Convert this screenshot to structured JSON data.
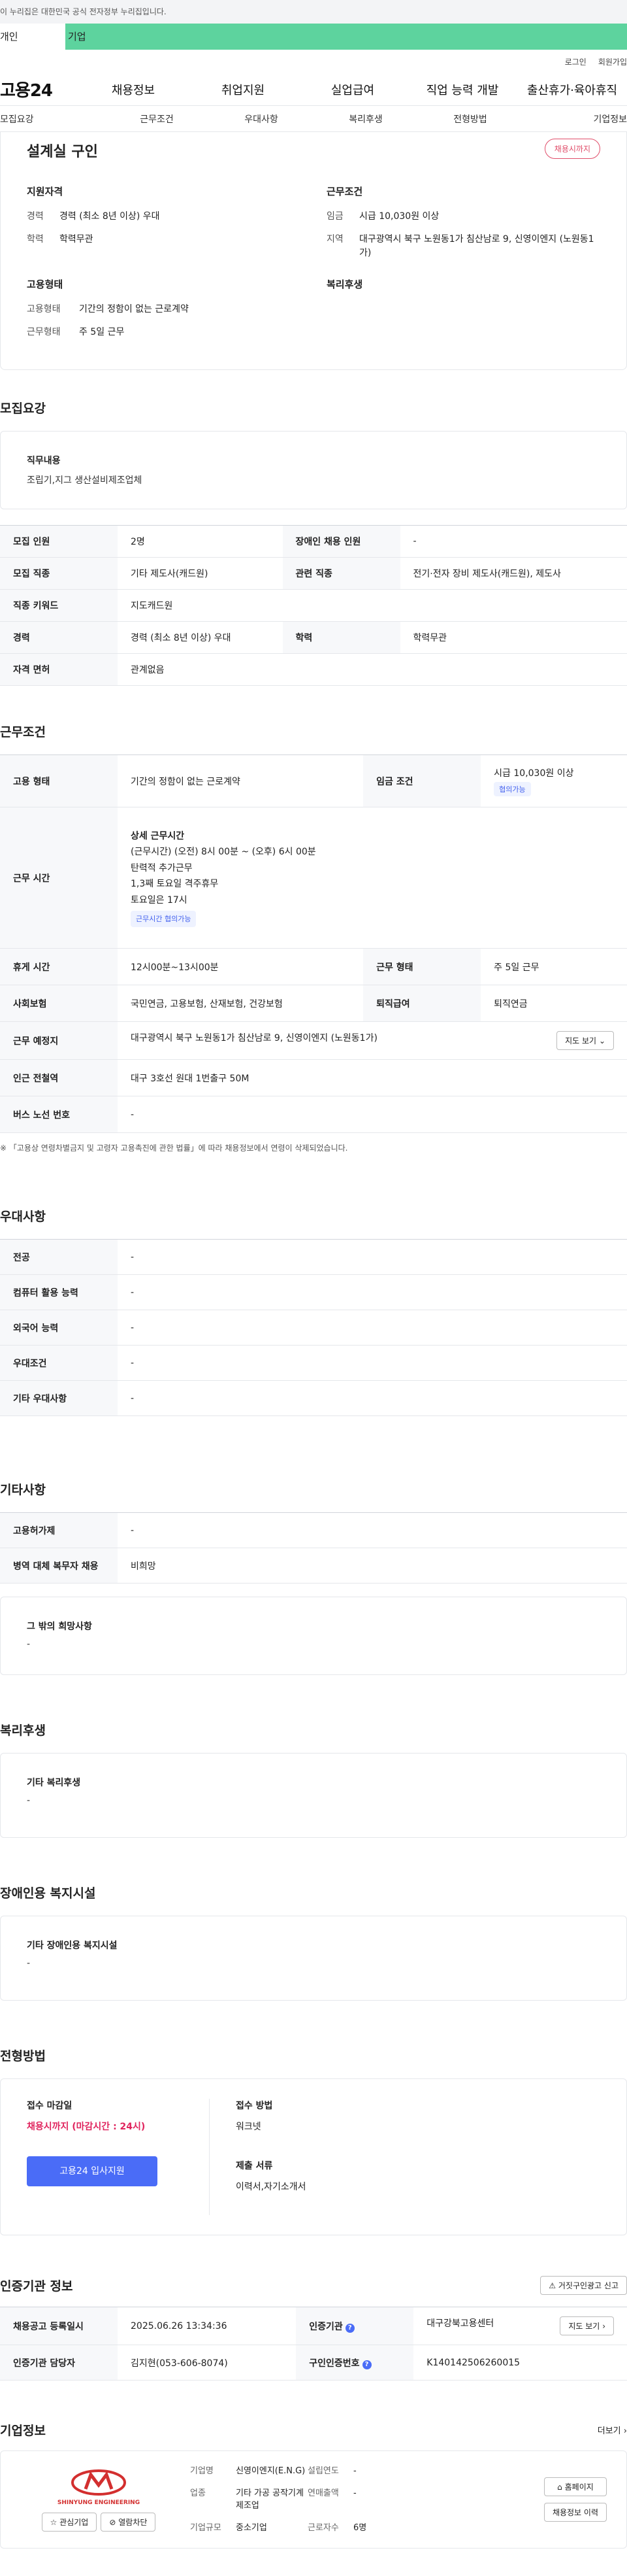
{
  "gov_banner": "이 누리집은 대한민국 공식 전자정부 누리집입니다.",
  "user_tabs": [
    "개인",
    "기업"
  ],
  "util": [
    "로그인",
    "회원가입"
  ],
  "logo": "고용24",
  "gnb": [
    "채용정보",
    "취업지원",
    "실업급여",
    "직업 능력 개발",
    "출산휴가·육아휴직"
  ],
  "subnav": [
    "모집요강",
    "근무조건",
    "우대사항",
    "복리후생",
    "전형방법",
    "기업정보"
  ],
  "summary": {
    "title": "설계실 구인",
    "badge": "채용시까지",
    "qual_h": "지원자격",
    "qual": [
      {
        "k": "경력",
        "v": "경력 (최소 8년 이상) 우대"
      },
      {
        "k": "학력",
        "v": "학력무관"
      }
    ],
    "emp_h": "고용형태",
    "emp": [
      {
        "k": "고용형태",
        "v": "기간의 정함이 없는 근로계약"
      },
      {
        "k": "근무형태",
        "v": "주 5일 근무"
      }
    ],
    "work_h": "근무조건",
    "work": [
      {
        "k": "임금",
        "v": "시급 10,030원 이상"
      },
      {
        "k": "지역",
        "v": "대구광역시 북구 노원동1가 침산남로 9, 신영이엔지 (노원동1가)"
      }
    ],
    "welfare_h": "복리후생"
  },
  "recruit": {
    "title": "모집요강",
    "duty_h": "직무내용",
    "duty": "조립기,지그  생산설비제조업체",
    "rows": [
      [
        "모집 인원",
        "2명",
        "장애인 채용 인원",
        "-"
      ],
      [
        "모집 직종",
        "기타 제도사(캐드원)",
        "관련 직종",
        "전기·전자 장비 제도사(캐드원), 제도사"
      ],
      [
        "직종 키워드",
        "지도캐드원"
      ],
      [
        "경력",
        "경력 (최소 8년 이상) 우대",
        "학력",
        "학력무관"
      ],
      [
        "자격 면허",
        "관계없음"
      ]
    ]
  },
  "cond": {
    "title": "근무조건",
    "r1": [
      "고용 형태",
      "기간의 정함이 없는 근로계약",
      "임금 조건",
      "시급 10,030원 이상",
      "협의가능"
    ],
    "hours_h": "근무 시간",
    "hours": [
      "상세 근무시간",
      "(근무시간) (오전) 8시 00분 ~ (오후) 6시 00분",
      "탄력적 추가근무",
      "1,3째 토요일 격주휴무",
      "토요일은 17시"
    ],
    "hours_chip": "근무시간 협의가능",
    "r3": [
      "휴게 시간",
      "12시00분~13시00분",
      "근무 형태",
      "주 5일 근무"
    ],
    "r4": [
      "사회보험",
      "국민연금, 고용보험, 산재보험, 건강보험",
      "퇴직급여",
      "퇴직연금"
    ],
    "r5": [
      "근무 예정지",
      "대구광역시 북구 노원동1가 침산남로 9, 신영이엔지 (노원동1가)"
    ],
    "map_btn": "지도 보기",
    "r6": [
      "인근 전철역",
      "대구 3호선 원대 1번출구 50M"
    ],
    "r7": [
      "버스 노선 번호",
      "-"
    ],
    "note": "※ 「고용상 연령차별금지 및 고령자 고용촉진에 관한 법률」에 따라 채용정보에서 연령이 삭제되었습니다."
  },
  "pref": {
    "title": "우대사항",
    "rows": [
      [
        "전공",
        "-"
      ],
      [
        "컴퓨터 활용 능력",
        "-"
      ],
      [
        "외국어 능력",
        "-"
      ],
      [
        "우대조건",
        "-"
      ],
      [
        "기타 우대사항",
        "-"
      ]
    ]
  },
  "etc": {
    "title": "기타사항",
    "rows": [
      [
        "고용허가제",
        "-"
      ],
      [
        "병역 대체 복무자 채용",
        "비희망"
      ]
    ],
    "box_h": "그 밖의 희망사항",
    "box_v": "-"
  },
  "welfare": {
    "title": "복리후생",
    "box_h": "기타 복리후생",
    "box_v": "-"
  },
  "disab": {
    "title": "장애인용 복지시설",
    "box_h": "기타 장애인용 복지시설",
    "box_v": "-"
  },
  "select": {
    "title": "전형방법",
    "deadline_h": "접수 마감일",
    "deadline": "채용시까지 (마감시간 : 24시)",
    "apply": "고용24 입사지원",
    "method_h": "접수 방법",
    "method": "워크넷",
    "docs_h": "제출 서류",
    "docs": "이력서,자기소개서"
  },
  "cert": {
    "title": "인증기관 정보",
    "report_btn": "거짓구인광고 신고",
    "r1": [
      "채용공고 등록일시",
      "2025.06.26 13:34:36",
      "인증기관",
      "대구강북고용센터"
    ],
    "map_btn": "지도 보기",
    "r2": [
      "인증기관 담당자",
      "김지현(053-606-8074)",
      "구인인증번호",
      "K140142506260015"
    ]
  },
  "company": {
    "title": "기업정보",
    "more": "더보기",
    "logo_text": "SHINYUNG ENGINEERING",
    "fav": "관심기업",
    "block": "열람차단",
    "name_k": "기업명",
    "name_v": "신영이엔지(E.N.G)",
    "ind_k": "업종",
    "ind_v": "기타 가공 공작기계 제조업",
    "size_k": "기업규모",
    "size_v": "중소기업",
    "year_k": "설립연도",
    "year_v": "-",
    "sales_k": "연매출액",
    "sales_v": "-",
    "emp_k": "근로자수",
    "emp_v": "6명",
    "home": "홈페이지",
    "hist": "채용정보 이력"
  },
  "colors": {
    "accent": "#4a6cf7",
    "badge": "#e04e6a",
    "tab_green": "#5dd39e"
  }
}
